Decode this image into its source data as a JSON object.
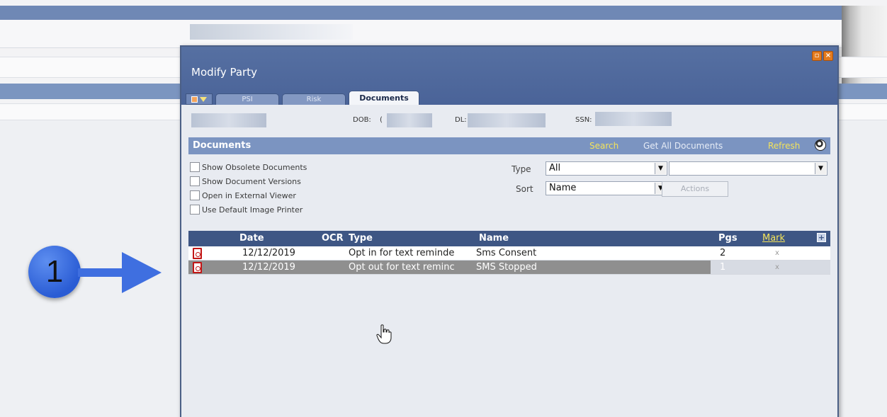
{
  "dialog": {
    "title": "Modify Party",
    "tabs": [
      "PSI",
      "Risk",
      "Documents"
    ],
    "active_tab": "Documents",
    "window_buttons": [
      "restore",
      "close"
    ]
  },
  "info": {
    "dob_label": "DOB:",
    "dob_prefix": "(",
    "dl_label": "DL:",
    "ssn_label": "SSN:"
  },
  "documents": {
    "section_title": "Documents",
    "links": {
      "search": "Search",
      "get_all": "Get All Documents",
      "refresh": "Refresh"
    },
    "options": [
      "Show Obsolete Documents",
      "Show Document Versions",
      "Open in External Viewer",
      "Use Default Image Printer"
    ],
    "filters": {
      "type_label": "Type",
      "type_value": "All",
      "sort_label": "Sort",
      "sort_value": "Name",
      "secondary_value": ""
    },
    "actions_label": "Actions",
    "table": {
      "headers": {
        "date": "Date",
        "ocr": "OCR",
        "type": "Type",
        "name": "Name",
        "pgs": "Pgs",
        "mark": "Mark"
      },
      "rows": [
        {
          "date": "12/12/2019",
          "ocr": "",
          "type": "Opt in for text reminde",
          "name": "Sms Consent",
          "pgs": "2",
          "mark": "x"
        },
        {
          "date": "12/12/2019",
          "ocr": "",
          "type": "Opt out for text reminc",
          "name": "SMS Stopped",
          "pgs": "1",
          "mark": "x"
        }
      ]
    }
  },
  "annotation": {
    "step_number": "1"
  },
  "colors": {
    "accent_yellow": "#f4e35a",
    "header_blue": "#3e5684",
    "title_blue": "#4a6398",
    "selected_row": "#8f8f8f",
    "pdf_red": "#c21717"
  }
}
